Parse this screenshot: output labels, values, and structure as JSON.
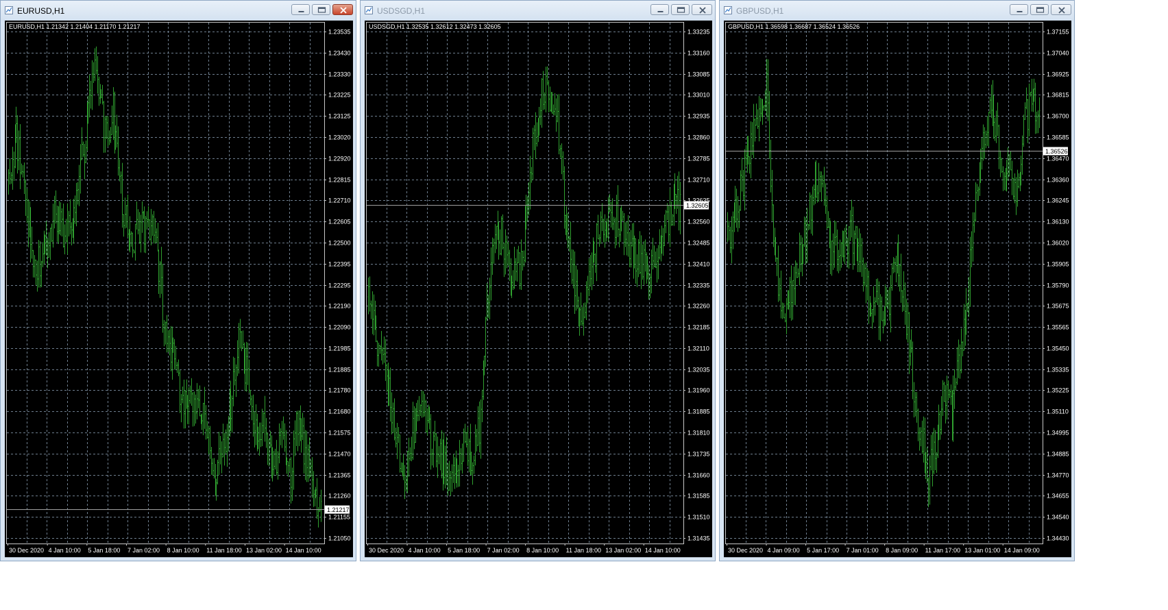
{
  "colors": {
    "background": "#000000",
    "grid": "#6f7f8f",
    "bar": "#2fa02f",
    "axis_text": "#ffffff",
    "bid_line": "#a0a0a0",
    "price_tag_bg": "#ffffff",
    "price_tag_text": "#000000"
  },
  "windows": [
    {
      "title": "EURUSD,H1",
      "active": true,
      "icon": "chart-window-icon",
      "legend": "EURUSD,H1  1.21342 1.21404 1.21170 1.21217",
      "chart_data": {
        "type": "ohlc_bar",
        "symbol": "EURUSD",
        "timeframe": "H1",
        "ylim": [
          1.2105,
          1.2361
        ],
        "price_labels": [
          "1.23535",
          "1.23430",
          "1.23330",
          "1.23225",
          "1.23125",
          "1.23020",
          "1.22920",
          "1.22815",
          "1.22710",
          "1.22605",
          "1.22500",
          "1.22395",
          "1.22295",
          "1.22190",
          "1.22090",
          "1.21985",
          "1.21885",
          "1.21780",
          "1.21680",
          "1.21575",
          "1.21470",
          "1.21365",
          "1.21260",
          "1.21155",
          "1.21050"
        ],
        "time_labels": [
          "30 Dec 2020",
          "4 Jan 10:00",
          "5 Jan 18:00",
          "7 Jan 02:00",
          "8 Jan 10:00",
          "11 Jan 18:00",
          "13 Jan 02:00",
          "14 Jan 10:00"
        ],
        "current_price": "1.21217",
        "current_value": 1.21217,
        "close_path": [
          [
            0,
            1.2283
          ],
          [
            6,
            1.2305
          ],
          [
            14,
            1.2272
          ],
          [
            20,
            1.2243
          ],
          [
            27,
            1.2244
          ],
          [
            34,
            1.2265
          ],
          [
            42,
            1.2258
          ],
          [
            50,
            1.2265
          ],
          [
            60,
            1.231
          ],
          [
            66,
            1.234
          ],
          [
            74,
            1.2305
          ],
          [
            80,
            1.2318
          ],
          [
            88,
            1.2265
          ],
          [
            96,
            1.2255
          ],
          [
            104,
            1.226
          ],
          [
            112,
            1.2265
          ],
          [
            118,
            1.222
          ],
          [
            126,
            1.2195
          ],
          [
            132,
            1.2175
          ],
          [
            138,
            1.217
          ],
          [
            144,
            1.2175
          ],
          [
            150,
            1.2168
          ],
          [
            158,
            1.214
          ],
          [
            166,
            1.2155
          ],
          [
            172,
            1.2185
          ],
          [
            176,
            1.2205
          ],
          [
            182,
            1.2188
          ],
          [
            188,
            1.2165
          ],
          [
            196,
            1.216
          ],
          [
            204,
            1.2147
          ],
          [
            210,
            1.2155
          ],
          [
            216,
            1.214
          ],
          [
            220,
            1.216
          ],
          [
            228,
            1.215
          ],
          [
            232,
            1.2143
          ],
          [
            236,
            1.2122
          ]
        ]
      }
    },
    {
      "title": "USDSGD,H1",
      "active": false,
      "icon": "chart-window-icon",
      "legend": "USDSGD,H1  1.32535 1.32612 1.32473 1.32605",
      "chart_data": {
        "type": "ohlc_bar",
        "symbol": "USDSGD",
        "timeframe": "H1",
        "ylim": [
          1.31405,
          1.33255
        ],
        "price_labels": [
          "1.33235",
          "1.33160",
          "1.33085",
          "1.33010",
          "1.32935",
          "1.32860",
          "1.32785",
          "1.32710",
          "1.32635",
          "1.32560",
          "1.32485",
          "1.32410",
          "1.32335",
          "1.32260",
          "1.32185",
          "1.32110",
          "1.32035",
          "1.31960",
          "1.31885",
          "1.31810",
          "1.31735",
          "1.31660",
          "1.31585",
          "1.31510",
          "1.31435"
        ],
        "time_labels": [
          "30 Dec 2020",
          "4 Jan 10:00",
          "5 Jan 18:00",
          "7 Jan 02:00",
          "8 Jan 10:00",
          "11 Jan 18:00",
          "13 Jan 02:00",
          "14 Jan 10:00"
        ],
        "current_price": "1.32605",
        "current_value": 1.32605,
        "close_path": [
          [
            0,
            1.3228
          ],
          [
            8,
            1.321
          ],
          [
            16,
            1.3197
          ],
          [
            22,
            1.3175
          ],
          [
            28,
            1.3162
          ],
          [
            34,
            1.318
          ],
          [
            40,
            1.3192
          ],
          [
            48,
            1.3178
          ],
          [
            56,
            1.317
          ],
          [
            64,
            1.316
          ],
          [
            72,
            1.3175
          ],
          [
            80,
            1.317
          ],
          [
            86,
            1.3185
          ],
          [
            94,
            1.3245
          ],
          [
            102,
            1.325
          ],
          [
            110,
            1.3235
          ],
          [
            118,
            1.324
          ],
          [
            126,
            1.328
          ],
          [
            132,
            1.33
          ],
          [
            140,
            1.33
          ],
          [
            146,
            1.3285
          ],
          [
            150,
            1.326
          ],
          [
            156,
            1.324
          ],
          [
            162,
            1.322
          ],
          [
            168,
            1.323
          ],
          [
            176,
            1.325
          ],
          [
            186,
            1.3255
          ],
          [
            194,
            1.3255
          ],
          [
            202,
            1.3245
          ],
          [
            210,
            1.324
          ],
          [
            216,
            1.3235
          ],
          [
            224,
            1.3245
          ],
          [
            232,
            1.326
          ]
        ]
      }
    },
    {
      "title": "GBPUSD,H1",
      "active": false,
      "icon": "chart-window-icon",
      "legend": "GBPUSD,H1  1.36598 1.36687 1.36524 1.36526",
      "chart_data": {
        "type": "ohlc_bar",
        "symbol": "GBPUSD",
        "timeframe": "H1",
        "ylim": [
          1.3441,
          1.3722
        ],
        "price_labels": [
          "1.37155",
          "1.37040",
          "1.36925",
          "1.36815",
          "1.36700",
          "1.36585",
          "1.36470",
          "1.36360",
          "1.36245",
          "1.36130",
          "1.36020",
          "1.35905",
          "1.35790",
          "1.35675",
          "1.35565",
          "1.35450",
          "1.35335",
          "1.35225",
          "1.35110",
          "1.34995",
          "1.34885",
          "1.34770",
          "1.34655",
          "1.34540",
          "1.34430"
        ],
        "time_labels": [
          "30 Dec 2020",
          "4 Jan 09:00",
          "5 Jan 17:00",
          "7 Jan 01:00",
          "8 Jan 09:00",
          "11 Jan 17:00",
          "13 Jan 01:00",
          "14 Jan 09:00"
        ],
        "current_price": "1.36526",
        "current_value": 1.36526,
        "close_path": [
          [
            0,
            1.3605
          ],
          [
            8,
            1.3625
          ],
          [
            16,
            1.365
          ],
          [
            24,
            1.3678
          ],
          [
            30,
            1.369
          ],
          [
            36,
            1.3595
          ],
          [
            42,
            1.3565
          ],
          [
            48,
            1.3575
          ],
          [
            54,
            1.359
          ],
          [
            60,
            1.361
          ],
          [
            66,
            1.363
          ],
          [
            72,
            1.364
          ],
          [
            78,
            1.36
          ],
          [
            86,
            1.3595
          ],
          [
            94,
            1.361
          ],
          [
            100,
            1.36
          ],
          [
            108,
            1.3575
          ],
          [
            116,
            1.3565
          ],
          [
            124,
            1.357
          ],
          [
            130,
            1.36
          ],
          [
            136,
            1.357
          ],
          [
            142,
            1.353
          ],
          [
            148,
            1.35
          ],
          [
            154,
            1.348
          ],
          [
            160,
            1.349
          ],
          [
            166,
            1.3525
          ],
          [
            172,
            1.351
          ],
          [
            180,
            1.355
          ],
          [
            186,
            1.359
          ],
          [
            192,
            1.364
          ],
          [
            198,
            1.367
          ],
          [
            204,
            1.3675
          ],
          [
            210,
            1.364
          ],
          [
            216,
            1.364
          ],
          [
            222,
            1.3625
          ],
          [
            228,
            1.367
          ],
          [
            234,
            1.368
          ],
          [
            240,
            1.3662
          ]
        ]
      }
    }
  ]
}
